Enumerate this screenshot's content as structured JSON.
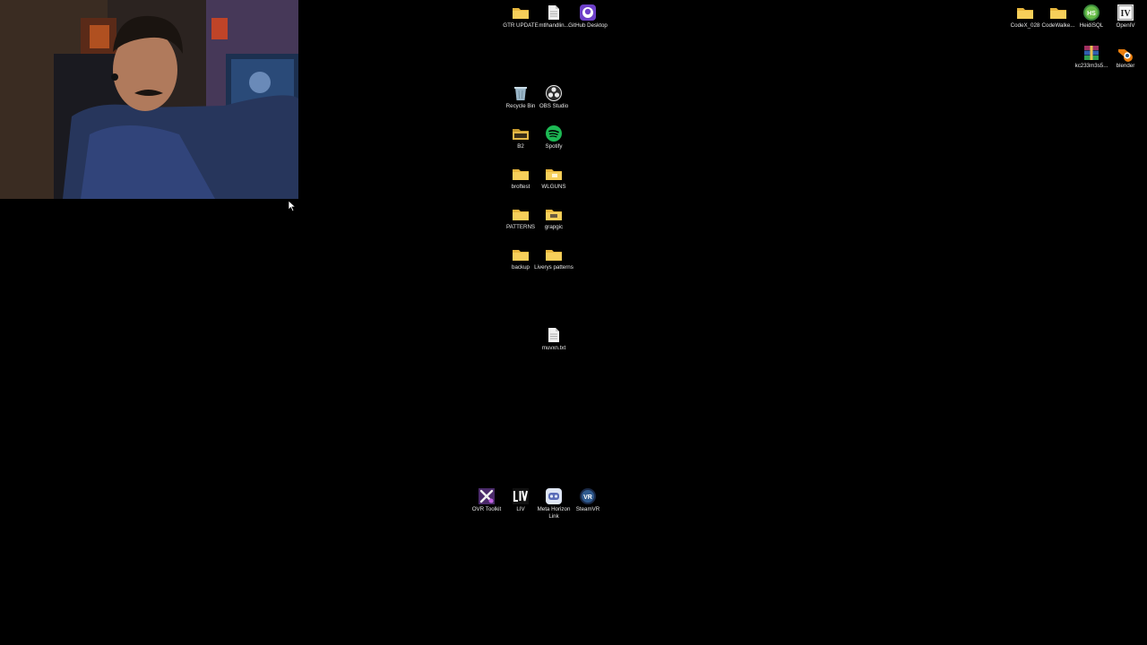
{
  "desktop_icons": [
    {
      "id": "gtr-update",
      "label": "GTR UPDATE",
      "icon": "folder-icon"
    },
    {
      "id": "mtlhandling",
      "label": "mtlhandlin...",
      "icon": "text-file-icon"
    },
    {
      "id": "github-desktop",
      "label": "GitHub Desktop",
      "icon": "github-desktop-icon"
    },
    {
      "id": "recycle-bin",
      "label": "Recycle Bin",
      "icon": "recycle-bin-icon"
    },
    {
      "id": "obs-studio",
      "label": "OBS Studio",
      "icon": "obs-studio-icon"
    },
    {
      "id": "b2",
      "label": "B2",
      "icon": "folder-dark-icon"
    },
    {
      "id": "spotify",
      "label": "Spotify",
      "icon": "spotify-icon"
    },
    {
      "id": "broftest",
      "label": "broftest",
      "icon": "folder-icon"
    },
    {
      "id": "wlguns",
      "label": "WLGUNS",
      "icon": "folder-icon"
    },
    {
      "id": "patterns",
      "label": "PATTERNS",
      "icon": "folder-icon"
    },
    {
      "id": "grapgic",
      "label": "grapgic",
      "icon": "folder-icon"
    },
    {
      "id": "backup",
      "label": "backup",
      "icon": "folder-icon"
    },
    {
      "id": "liverys-patterns",
      "label": "Liverys patterns",
      "icon": "folder-icon"
    },
    {
      "id": "muvxn-txt",
      "label": "muvxn.txt",
      "icon": "text-file-icon"
    },
    {
      "id": "ovr-toolkit",
      "label": "OVR Toolkit",
      "icon": "ovr-toolkit-icon"
    },
    {
      "id": "liv",
      "label": "LIV",
      "icon": "liv-icon"
    },
    {
      "id": "meta-horizon-link",
      "label": "Meta Horizon Link",
      "icon": "meta-horizon-link-icon"
    },
    {
      "id": "steamvr",
      "label": "SteamVR",
      "icon": "steamvr-icon"
    },
    {
      "id": "codex-028",
      "label": "CodeX_028",
      "icon": "folder-icon"
    },
    {
      "id": "codewalker",
      "label": "CodeWalke...",
      "icon": "folder-icon"
    },
    {
      "id": "heidisql",
      "label": "HeidiSQL",
      "icon": "heidisql-icon"
    },
    {
      "id": "openiv",
      "label": "OpenIV",
      "icon": "openiv-icon"
    },
    {
      "id": "kc233m3s5",
      "label": "kc233m3s5...",
      "icon": "winrar-archive-icon"
    },
    {
      "id": "blender",
      "label": "blender",
      "icon": "blender-icon"
    }
  ],
  "colors": {
    "background": "#000000",
    "folder": "#f0c44c",
    "spotify": "#1db954",
    "github": "#6e40c9"
  }
}
